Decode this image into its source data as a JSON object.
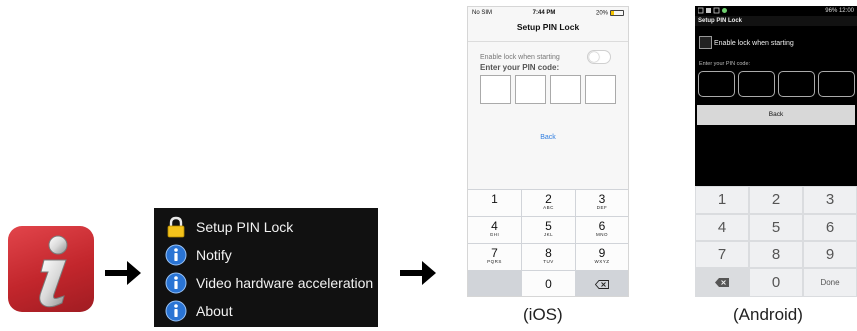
{
  "app_icon": {
    "name": "info-app-icon",
    "accent": "#c9282e"
  },
  "menu": {
    "items": [
      {
        "label": "Setup PIN Lock",
        "icon": "lock-icon"
      },
      {
        "label": "Notify",
        "icon": "info-icon"
      },
      {
        "label": "Video hardware acceleration",
        "icon": "info-icon"
      },
      {
        "label": "About",
        "icon": "info-icon"
      }
    ]
  },
  "ios": {
    "status": {
      "carrier": "No SIM",
      "time": "7:44 PM",
      "battery": "20%"
    },
    "title": "Setup PIN Lock",
    "enable_label": "Enable lock when starting",
    "enter_label": "Enter your PIN code:",
    "back_label": "Back",
    "keypad": [
      {
        "num": "1",
        "sub": ""
      },
      {
        "num": "2",
        "sub": "ABC"
      },
      {
        "num": "3",
        "sub": "DEF"
      },
      {
        "num": "4",
        "sub": "GHI"
      },
      {
        "num": "5",
        "sub": "JKL"
      },
      {
        "num": "6",
        "sub": "MNO"
      },
      {
        "num": "7",
        "sub": "PQRS"
      },
      {
        "num": "8",
        "sub": "TUV"
      },
      {
        "num": "9",
        "sub": "WXYZ"
      },
      {
        "num": "0",
        "sub": ""
      }
    ],
    "caption": "(iOS)"
  },
  "android": {
    "status": {
      "right": "96% 12:00"
    },
    "title": "Setup PIN Lock",
    "enable_label": "Enable lock when starting",
    "enter_label": "Enter your PIN code:",
    "back_label": "Back",
    "keypad": [
      "1",
      "2",
      "3",
      "4",
      "5",
      "6",
      "7",
      "8",
      "9",
      "0"
    ],
    "done_label": "Done",
    "caption": "(Android)"
  }
}
